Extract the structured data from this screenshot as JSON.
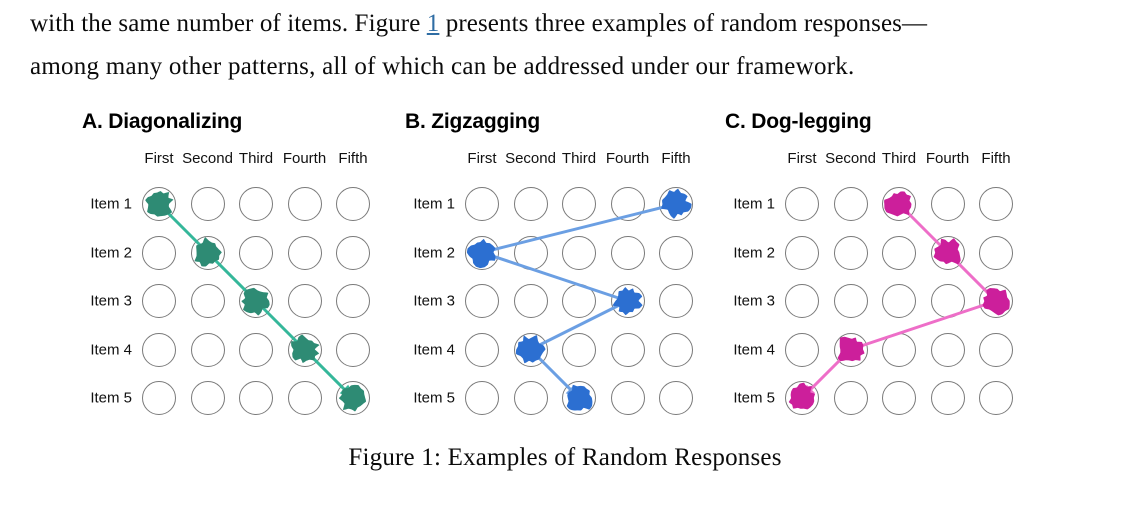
{
  "paragraph": {
    "line1_before": "with the same number of items. Figure ",
    "ref": "1",
    "line1_after": " presents three examples of random responses—",
    "line2": "among many other patterns, all of which can be addressed under our framework.",
    "ref_color": "#2f6da4"
  },
  "caption": "Figure 1: Examples of Random Responses",
  "chart_data": {
    "type": "scatter",
    "title": "Figure 1: Examples of Random Responses",
    "categories": [
      "First",
      "Second",
      "Third",
      "Fourth",
      "Fifth"
    ],
    "rows": [
      "Item 1",
      "Item 2",
      "Item 3",
      "Item 4",
      "Item 5"
    ],
    "xlabel": "",
    "ylabel": "",
    "grid": false,
    "legend": "none",
    "panels": [
      {
        "id": "A",
        "title": "A. Diagonalizing",
        "color": "#2e8b74",
        "line_color": "#35b79a",
        "x": [
          "First",
          "Second",
          "Third",
          "Fourth",
          "Fifth"
        ],
        "y": [
          "Item 1",
          "Item 2",
          "Item 3",
          "Item 4",
          "Item 5"
        ],
        "values": [
          1,
          2,
          3,
          4,
          5
        ],
        "path_order": [
          1,
          2,
          3,
          4,
          5
        ]
      },
      {
        "id": "B",
        "title": "B. Zigzagging",
        "color": "#2c6fd1",
        "line_color": "#6b9fe3",
        "x": [
          "Fifth",
          "First",
          "Fourth",
          "Second",
          "Third"
        ],
        "y": [
          "Item 1",
          "Item 2",
          "Item 3",
          "Item 4",
          "Item 5"
        ],
        "values": [
          5,
          1,
          4,
          2,
          3
        ],
        "path_order": [
          5,
          1,
          4,
          2,
          3
        ]
      },
      {
        "id": "C",
        "title": "C. Dog-legging",
        "color": "#cc1f9b",
        "line_color": "#ee6ec8",
        "x": [
          "Third",
          "Fourth",
          "Fifth",
          "Second",
          "First"
        ],
        "y": [
          "Item 1",
          "Item 2",
          "Item 3",
          "Item 4",
          "Item 5"
        ],
        "values": [
          3,
          4,
          5,
          2,
          1
        ],
        "path_order": [
          3,
          4,
          5,
          2,
          1
        ]
      }
    ]
  }
}
